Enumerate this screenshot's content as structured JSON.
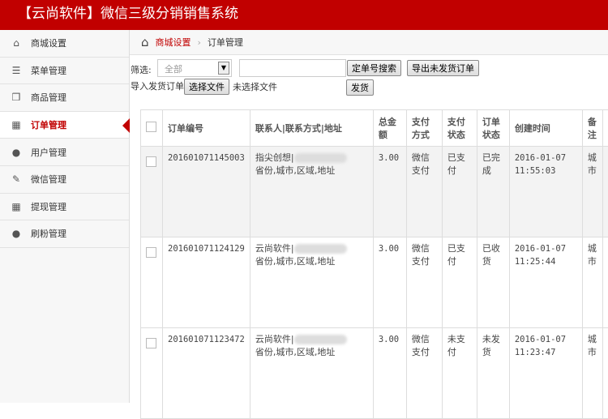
{
  "header": {
    "title": "【云尚软件】微信三级分销销售系统"
  },
  "sidebar": {
    "items": [
      {
        "label": "商城设置",
        "icon": "home-icon",
        "glyph": "⌂"
      },
      {
        "label": "菜单管理",
        "icon": "list-icon",
        "glyph": "☰"
      },
      {
        "label": "商品管理",
        "icon": "gift-icon",
        "glyph": "❒"
      },
      {
        "label": "订单管理",
        "icon": "calendar-icon",
        "glyph": "▦",
        "active": true
      },
      {
        "label": "用户管理",
        "icon": "users-icon",
        "glyph": "●"
      },
      {
        "label": "微信管理",
        "icon": "edit-icon",
        "glyph": "✎"
      },
      {
        "label": "提现管理",
        "icon": "calendar-icon",
        "glyph": "▦"
      },
      {
        "label": "刷粉管理",
        "icon": "users-icon",
        "glyph": "●"
      }
    ]
  },
  "breadcrumb": {
    "home": "商城设置",
    "current": "订单管理"
  },
  "filter": {
    "label": "筛选:",
    "select_value": "全部",
    "search_btn": "定单号搜索",
    "export_btn": "导出未发货订单",
    "import_label": "导入发货订单",
    "choose_file": "选择文件",
    "no_file": "未选择文件",
    "ship_btn": "发货"
  },
  "table": {
    "headers": [
      "订单编号",
      "联系人|联系方式|地址",
      "总金额",
      "支付方式",
      "支付状态",
      "订单状态",
      "创建时间",
      "备注"
    ],
    "rows": [
      {
        "id": "201601071145003",
        "contact": "指尖创想|",
        "address": "省份,城市,区域,地址",
        "amount": "3.00",
        "pay_method": "微信支付",
        "pay_status": "已支付",
        "order_status": "已完成",
        "date": "2016-01-07",
        "time": "11:55:03",
        "note": "城市"
      },
      {
        "id": "201601071124129",
        "contact": "云尚软件|",
        "address": "省份,城市,区域,地址",
        "amount": "3.00",
        "pay_method": "微信支付",
        "pay_status": "已支付",
        "order_status": "已收货",
        "date": "2016-01-07",
        "time": "11:25:44",
        "note": "城市"
      },
      {
        "id": "201601071123472",
        "contact": "云尚软件|",
        "address": "省份,城市,区域,地址",
        "amount": "3.00",
        "pay_method": "微信支付",
        "pay_status": "未支付",
        "order_status": "未发货",
        "date": "2016-01-07",
        "time": "11:23:47",
        "note": "城市"
      }
    ]
  }
}
